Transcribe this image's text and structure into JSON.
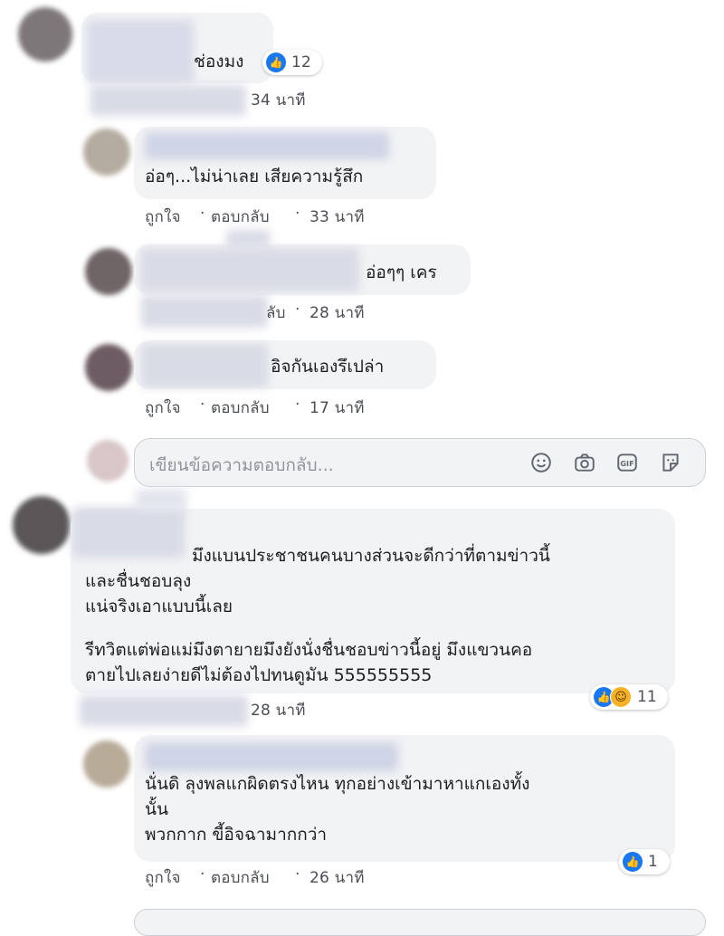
{
  "comments": [
    {
      "text_lines": [
        "ช่องมง"
      ],
      "reaction_count": "12",
      "time": "34 นาที"
    },
    {
      "text_lines": [
        "อ่อๆ...ไม่น่าเลย เสียความรู้สึก"
      ],
      "like_label": "ถูกใจ",
      "reply_label": "ตอบกลับ",
      "time": "33 นาที"
    },
    {
      "text_lines": [
        "อ่อๆๆ เคร"
      ],
      "reply_label_partial": "ลับ",
      "time": "28 นาที"
    },
    {
      "text_lines": [
        "อิจกันเองรึเปล่า"
      ],
      "like_label": "ถูกใจ",
      "reply_label": "ตอบกลับ",
      "time": "17 นาที"
    }
  ],
  "reply_input": {
    "placeholder": "เขียนข้อความตอบกลับ..."
  },
  "comment_main": {
    "text_lines": [
      "มึงแบนประชาชนคนบางส่วนจะดีกว่าที่ตามข่าวนี้",
      "และชื่นชอบลุง",
      "แน่จริงเอาแบบนี้เลย",
      "รีทวิตแต่พ่อแม่มึงตายายมึงยังนั่งชื่นชอบข่าวนี้อยู่ มึงแขวนคอ",
      "ตายไปเลยง่ายดีไม่ต้องไปทนดูมัน 555555555"
    ],
    "reaction_count": "11",
    "time": "28 นาที"
  },
  "reply_main": {
    "text_lines": [
      "นั่นดิ ลุงพลแกผิดตรงไหน ทุกอย่างเข้ามาหาแกเองทั้ง",
      "นั้น",
      "พวกกาก ขี้อิจฉามากกว่า"
    ],
    "reaction_count": "1",
    "like_label": "ถูกใจ",
    "reply_label": "ตอบกลับ",
    "time": "26 นาที"
  },
  "separator": "·",
  "icons": {
    "like": "like-icon",
    "haha": "haha-icon",
    "emoji": "emoji-icon",
    "camera": "camera-icon",
    "gif": "gif-icon",
    "sticker": "sticker-icon"
  },
  "colors": {
    "bubble": "#f2f3f5",
    "like_blue": "#1877f2",
    "meta": "#4b4f56",
    "placeholder": "#90949c"
  }
}
